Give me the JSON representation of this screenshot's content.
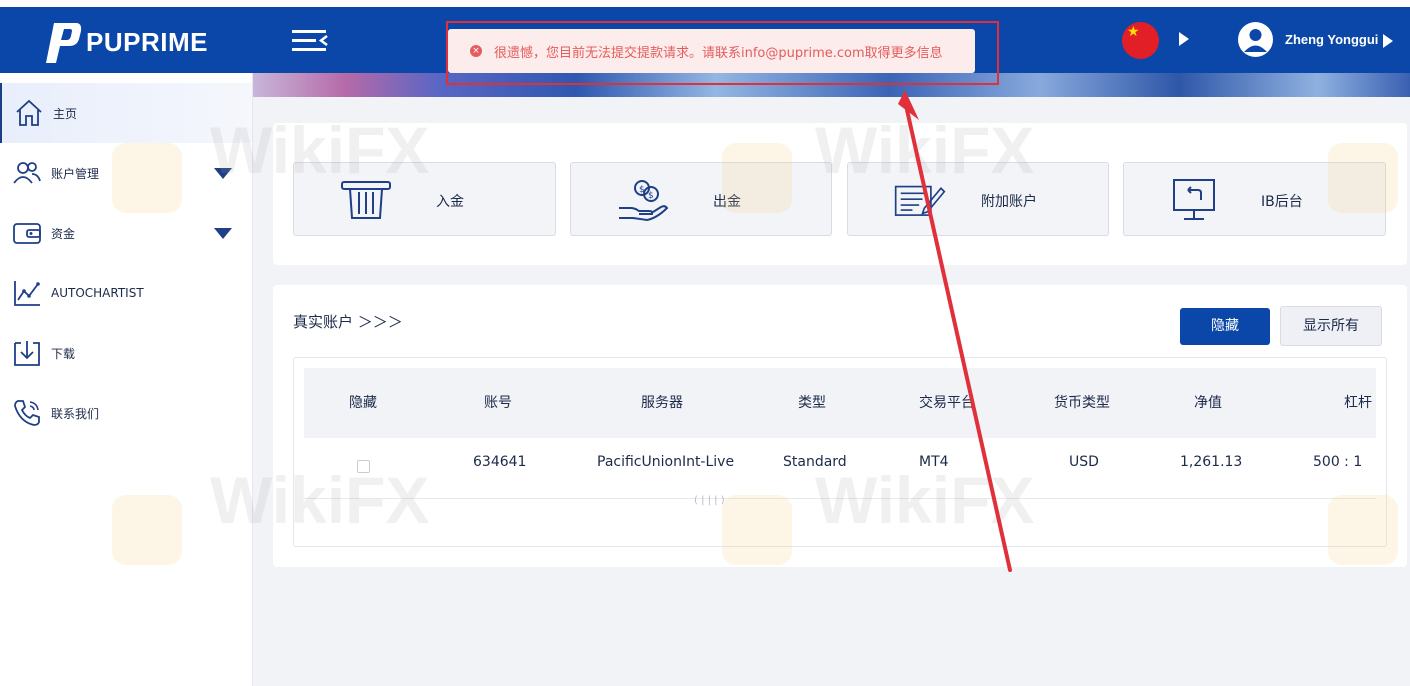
{
  "header": {
    "brand": "PUPRIME",
    "username": "Zheng Yonggui"
  },
  "alert": {
    "message": "很遗憾，您目前无法提交提款请求。请联系info@puprime.com取得更多信息"
  },
  "sidebar": {
    "items": [
      {
        "label": "主页",
        "icon": "home-icon",
        "active": true
      },
      {
        "label": "账户管理",
        "icon": "users-icon",
        "expandable": true
      },
      {
        "label": "资金",
        "icon": "wallet-icon",
        "expandable": true
      },
      {
        "label": "AUTOCHARTIST",
        "icon": "chart-line-icon"
      },
      {
        "label": "下载",
        "icon": "download-icon"
      },
      {
        "label": "联系我们",
        "icon": "phone-icon"
      }
    ]
  },
  "quick_actions": [
    {
      "label": "入金",
      "icon": "card-slot-icon"
    },
    {
      "label": "出金",
      "icon": "hand-coins-icon"
    },
    {
      "label": "附加账户",
      "icon": "document-edit-icon"
    },
    {
      "label": "IB后台",
      "icon": "monitor-icon"
    }
  ],
  "accounts": {
    "title": "真实账户 ＞＞＞",
    "hide_button": "隐藏",
    "show_all_button": "显示所有",
    "columns": [
      "隐藏",
      "账号",
      "服务器",
      "类型",
      "交易平台",
      "货币类型",
      "净值",
      "杠杆"
    ],
    "rows": [
      {
        "hidden": false,
        "account": "634641",
        "server": "PacificUnionInt-Live",
        "type": "Standard",
        "platform": "MT4",
        "currency": "USD",
        "equity": "1,261.13",
        "leverage": "500 : 1"
      }
    ],
    "scroll_hint": "( | | | )"
  },
  "watermark": "WikiFX",
  "colors": {
    "brand_blue": "#0a47a8",
    "alert_red": "#e45c5c",
    "annotation_red": "#e0313a"
  }
}
